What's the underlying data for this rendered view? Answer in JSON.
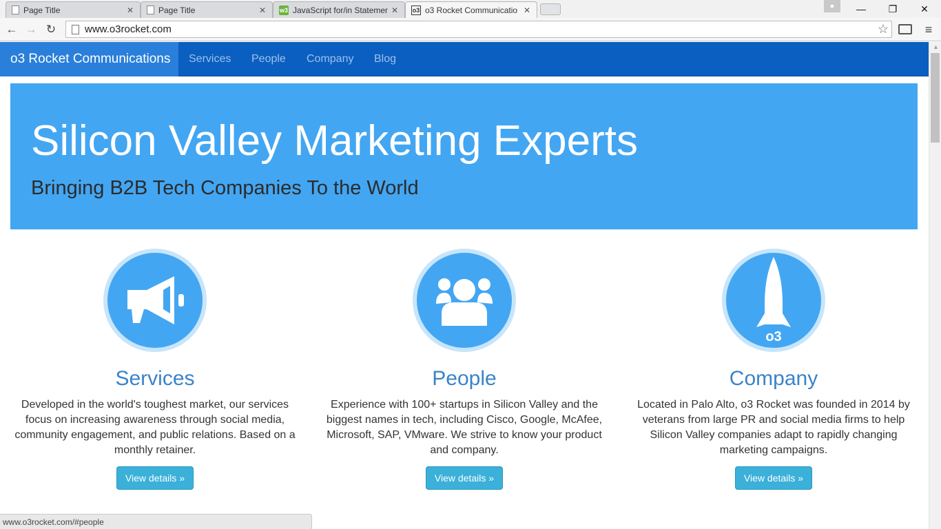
{
  "browser": {
    "tabs": [
      {
        "title": "Page Title",
        "icon": "document-icon",
        "active": false
      },
      {
        "title": "Page Title",
        "icon": "document-icon",
        "active": false
      },
      {
        "title": "JavaScript for/in Statemen",
        "icon": "w3schools-icon",
        "active": false
      },
      {
        "title": "o3 Rocket Communicatio",
        "icon": "o3-icon",
        "active": true
      }
    ],
    "close_glyph": "✕",
    "url": "www.o3rocket.com",
    "window_controls": {
      "minimize": "—",
      "restore": "❐",
      "close": "✕"
    },
    "status_url": "www.o3rocket.com/#people"
  },
  "site": {
    "brand": "o3 Rocket Communications",
    "nav": [
      "Services",
      "People",
      "Company",
      "Blog"
    ],
    "hero": {
      "title": "Silicon Valley Marketing Experts",
      "subtitle": "Bringing B2B Tech Companies To the World"
    },
    "columns": [
      {
        "heading": "Services",
        "icon": "megaphone-icon",
        "text": "Developed in the world's toughest market, our services focus on increasing awareness through social media, community engagement, and public relations. Based on a monthly retainer.",
        "button": "View details »"
      },
      {
        "heading": "People",
        "icon": "people-icon",
        "text": "Experience with 100+ startups in Silicon Valley and the biggest names in tech, including Cisco, Google, McAfee, Microsoft, SAP, VMware. We strive to know your product and company.",
        "button": "View details »"
      },
      {
        "heading": "Company",
        "icon": "rocket-icon",
        "text": "Located in Palo Alto, o3 Rocket was founded in 2014 by veterans from large PR and social media firms to help Silicon Valley companies adapt to rapidly changing marketing campaigns.",
        "button": "View details »",
        "logo_text": "o3"
      }
    ]
  },
  "colors": {
    "nav_bg": "#0a5fc1",
    "brand_bg": "#2a7fda",
    "hero_bg": "#43a6f2",
    "heading": "#3a83c9",
    "button": "#3bb0d9"
  }
}
